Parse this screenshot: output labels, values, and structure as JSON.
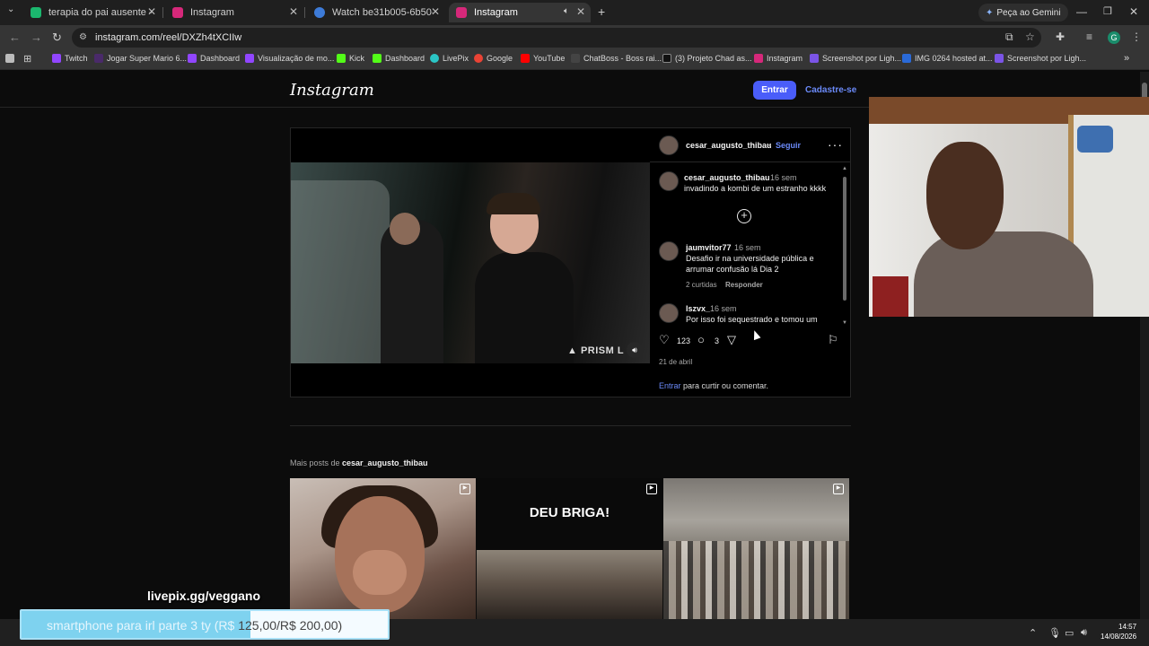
{
  "browser": {
    "tabs": [
      {
        "label": "terapia do pai ausente - Imgur",
        "color": "#1bb76e"
      },
      {
        "label": "Instagram",
        "color": "#d6287a"
      },
      {
        "label": "Watch be31b005-6b50-4225-8",
        "color": "#3d7bd8"
      },
      {
        "label": "Instagram",
        "color": "#d6287a"
      }
    ],
    "new_tab": "+",
    "gemini_label": "Peça ao Gemini",
    "url": "instagram.com/reel/DXZh4tXCIIw",
    "profile_initial": "G",
    "bookmarks": [
      {
        "label": "Twitch",
        "color": "#9146ff"
      },
      {
        "label": "Jogar Super Mario 6...",
        "color": "#4a2a6a"
      },
      {
        "label": "Dashboard",
        "color": "#9146ff"
      },
      {
        "label": "Visualização de mo...",
        "color": "#9146ff"
      },
      {
        "label": "Kick",
        "color": "#53fc18"
      },
      {
        "label": "Dashboard",
        "color": "#53fc18"
      },
      {
        "label": "LivePix",
        "color": "#2bc6c6"
      },
      {
        "label": "Google",
        "color": "#ea4335"
      },
      {
        "label": "YouTube",
        "color": "#ff0000"
      },
      {
        "label": "ChatBoss - Boss rai...",
        "color": "#444444"
      },
      {
        "label": "(3) Projeto Chad as...",
        "color": "#111111"
      },
      {
        "label": "Instagram",
        "color": "#d6287a"
      },
      {
        "label": "Screenshot por Ligh...",
        "color": "#7b54e6"
      },
      {
        "label": "IMG 0264 hosted at...",
        "color": "#2a6ad8"
      },
      {
        "label": "Screenshot por Ligh...",
        "color": "#7b54e6"
      }
    ]
  },
  "instagram": {
    "logo": "Instagram",
    "login_button": "Entrar",
    "signup_link": "Cadastre-se",
    "post": {
      "author": "cesar_augusto_thibau",
      "follow_separator": "•",
      "follow": "Seguir",
      "watermark": "▲ PRISM L",
      "caption": {
        "user": "cesar_augusto_thibau",
        "time": "16 sem",
        "text": "invadindo a kombi de um estranho kkkk"
      },
      "comments": [
        {
          "user": "jaumvitor77",
          "time": "16 sem",
          "text": "Desafio ir na universidade pública e arrumar confusão lá Dia 2",
          "likes": "2 curtidas",
          "reply": "Responder"
        },
        {
          "user": "lszvx_",
          "time": "16 sem",
          "text": "Por isso foi sequestrado e tomou um pau"
        }
      ],
      "likes": "123",
      "comment_count": "3",
      "date": "21 de abril",
      "login_prompt_link": "Entrar",
      "login_prompt_rest": " para curtir ou comentar."
    },
    "more_posts": {
      "prefix": "Mais posts de ",
      "user": "cesar_augusto_thibau"
    },
    "grid": [
      {
        "caption": ""
      },
      {
        "caption": "DEU BRIGA!"
      },
      {
        "caption": ""
      }
    ]
  },
  "overlay": {
    "livepix": "livepix.gg/veggano",
    "goal_text_a": "smartphone para irl parte 3 ty (R$ ",
    "goal_text_b": "125,00/R$ 200,00)",
    "goal_progress": 0.625
  },
  "taskbar": {
    "time": "14:57",
    "date": "14/08/2026"
  }
}
